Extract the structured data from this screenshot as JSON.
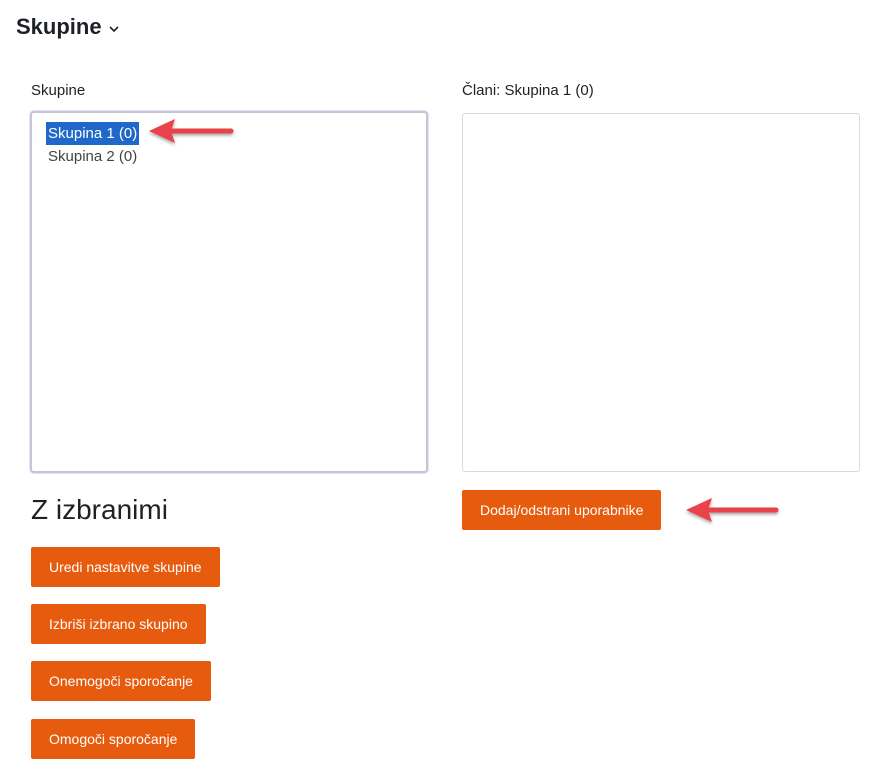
{
  "header": {
    "title": "Skupine",
    "chevron_icon": "chevron-down-icon"
  },
  "groups_panel": {
    "label": "Skupine",
    "options": [
      {
        "label": "Skupina 1 (0)",
        "selected": true
      },
      {
        "label": "Skupina 2 (0)",
        "selected": false
      }
    ]
  },
  "members_panel": {
    "label": "Člani: Skupina 1 (0)",
    "add_remove_button": "Dodaj/odstrani uporabnike"
  },
  "with_selected": {
    "heading": "Z izbranimi",
    "buttons": {
      "edit": "Uredi nastavitve skupine",
      "delete": "Izbriši izbrano skupino",
      "disable_messaging": "Onemogoči sporočanje",
      "enable_messaging": "Omogoči sporočanje"
    }
  },
  "colors": {
    "button": "#e65b0d",
    "selection": "#1f67c8",
    "annotation_arrow": "#e9434b"
  }
}
